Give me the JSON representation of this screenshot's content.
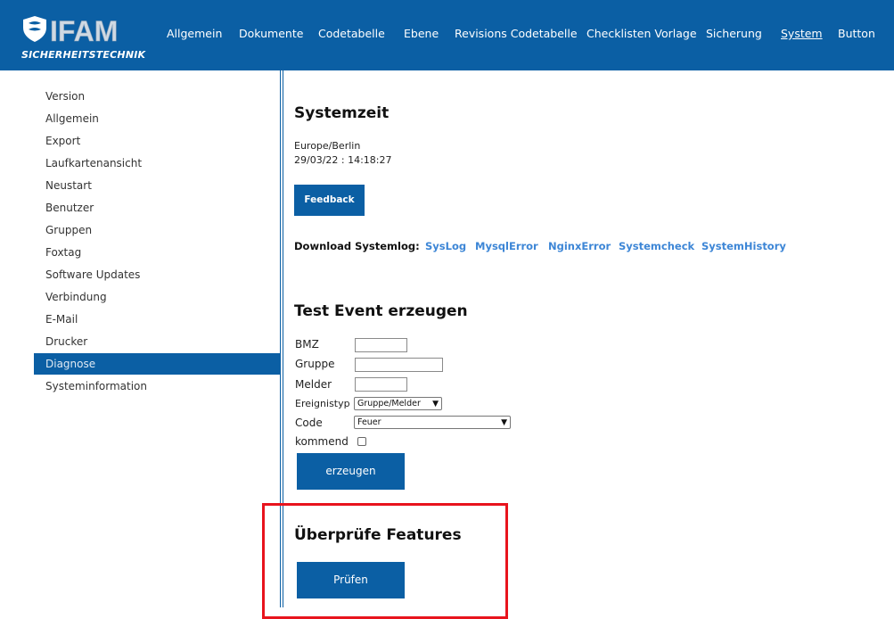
{
  "brand": {
    "name": "IFAM",
    "tagline": "SICHERHEITSTECHNIK"
  },
  "nav": [
    "Allgemein",
    "Dokumente",
    "Codetabelle",
    "Ebene",
    "Revisions Codetabelle",
    "Checklisten Vorlage",
    "Sicherung",
    "System",
    "Button"
  ],
  "nav_active": "System",
  "sidebar": [
    "Version",
    "Allgemein",
    "Export",
    "Laufkartenansicht",
    "Neustart",
    "Benutzer",
    "Gruppen",
    "Foxtag",
    "Software Updates",
    "Verbindung",
    "E-Mail",
    "Drucker",
    "Diagnose",
    "Systeminformation"
  ],
  "sidebar_active": "Diagnose",
  "systemzeit": {
    "title": "Systemzeit",
    "timezone": "Europe/Berlin",
    "datetime": "29/03/22 : 14:18:27",
    "feedback_label": "Feedback"
  },
  "download": {
    "label": "Download Systemlog:",
    "links": [
      "SysLog",
      "MysqlError",
      "NginxError",
      "Systemcheck",
      "SystemHistory"
    ]
  },
  "test_event": {
    "title": "Test Event erzeugen",
    "bmz_label": "BMZ",
    "gruppe_label": "Gruppe",
    "melder_label": "Melder",
    "ereignistyp_label": "Ereignistyp",
    "ereignistyp_value": "Gruppe/Melder",
    "code_label": "Code",
    "code_value": "Feuer",
    "kommend_label": "kommend",
    "submit_label": "erzeugen"
  },
  "features": {
    "title": "Überprüfe Features",
    "check_label": "Prüfen"
  },
  "colors": {
    "primary": "#0b5fa4",
    "link": "#3d86d6",
    "highlight": "#e8141d"
  }
}
